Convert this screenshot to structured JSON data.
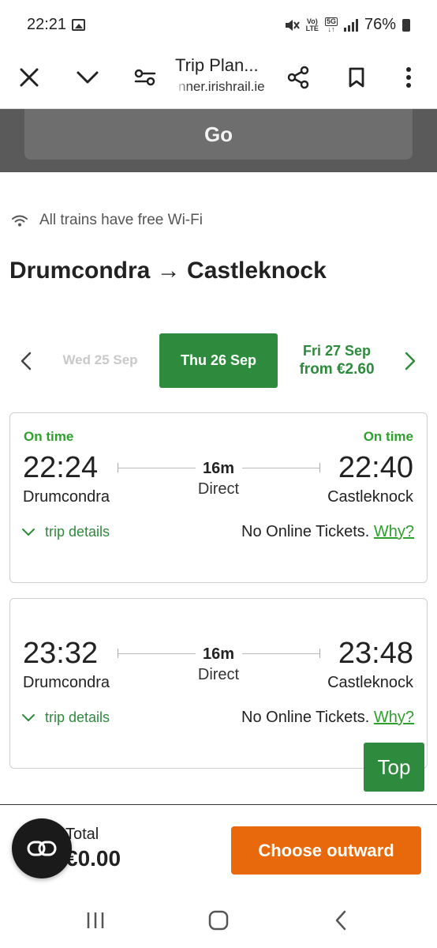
{
  "status_bar": {
    "time": "22:21",
    "network_top": "Vo)",
    "network_bottom": "LTE",
    "five_g": "5G",
    "battery": "76%"
  },
  "browser": {
    "title": "Trip Plan...",
    "url": "nner.irishrail.ie",
    "icons": [
      "close-icon",
      "chevron-down-icon",
      "tune-icon",
      "share-icon",
      "bookmark-icon",
      "more-vertical-icon"
    ]
  },
  "search": {
    "go_label": "Go"
  },
  "wifi_notice": "All trains have free Wi-Fi",
  "route_title": "Drumcondra → Castleknock",
  "dates": {
    "prev": "Wed 25 Sep",
    "active": "Thu 26 Sep",
    "next_date": "Fri 27 Sep",
    "next_price": "from €2.60"
  },
  "trips": [
    {
      "status_depart": "On time",
      "status_arrive": "On time",
      "depart_time": "22:24",
      "arrive_time": "22:40",
      "origin": "Drumcondra",
      "destination": "Castleknock",
      "duration": "16m",
      "type": "Direct",
      "details_label": "trip details",
      "tickets_text": "No Online Tickets.",
      "why_label": "Why?"
    },
    {
      "status_depart": "",
      "status_arrive": "",
      "depart_time": "23:32",
      "arrive_time": "23:48",
      "origin": "Drumcondra",
      "destination": "Castleknock",
      "duration": "16m",
      "type": "Direct",
      "details_label": "trip details",
      "tickets_text": "No Online Tickets.",
      "why_label": "Why?"
    }
  ],
  "top_button": "Top",
  "footer": {
    "total_label": "Total",
    "total_value": "€0.00",
    "choose_label": "Choose outward"
  },
  "colors": {
    "brand_green": "#2e8a3c",
    "status_green": "#2ea02e",
    "cta_orange": "#e8690c"
  }
}
